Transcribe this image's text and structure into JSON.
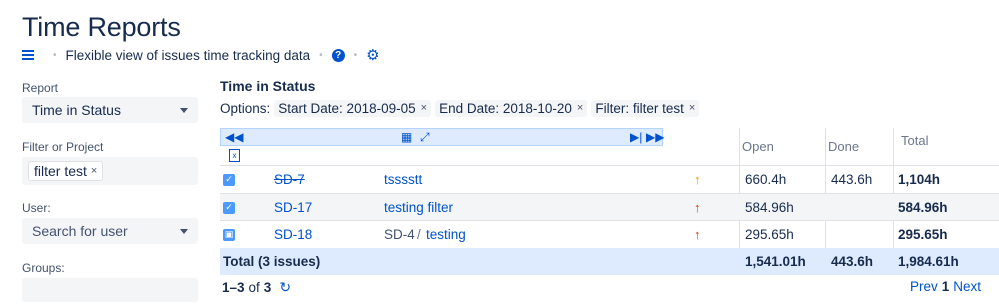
{
  "header": {
    "title": "Time Reports",
    "subtitle": "Flexible view of issues time tracking data",
    "help_glyph": "?",
    "gear_glyph": "⚙"
  },
  "sidebar": {
    "report_label": "Report",
    "report_value": "Time in Status",
    "filter_label": "Filter or Project",
    "filter_tag": "filter test",
    "user_label": "User:",
    "user_placeholder": "Search for user",
    "groups_label": "Groups:"
  },
  "report": {
    "section_title": "Time in Status",
    "options_label": "Options:",
    "options": [
      {
        "label": "Start Date: 2018-09-05"
      },
      {
        "label": "End Date: 2018-10-20"
      },
      {
        "label": "Filter: filter test"
      }
    ],
    "remove_glyph": "×",
    "columns": {
      "open": "Open",
      "done": "Done",
      "total": "Total"
    }
  },
  "rows": [
    {
      "key": "SD-7",
      "summary_parent": "",
      "summary": "tsssstt",
      "priority_color": "#ff8b00",
      "open": "660.4h",
      "done": "443.6h",
      "total": "1,104h",
      "resolved": true,
      "type": "task"
    },
    {
      "key": "SD-17",
      "summary_parent": "",
      "summary": "testing filter",
      "priority_color": "#de350b",
      "open": "584.96h",
      "done": "",
      "total": "584.96h",
      "resolved": false,
      "type": "task"
    },
    {
      "key": "SD-18",
      "summary_parent": "SD-4",
      "summary": "testing",
      "priority_color": "#de350b",
      "open": "295.65h",
      "done": "",
      "total": "295.65h",
      "resolved": false,
      "type": "subtask"
    }
  ],
  "totals": {
    "label": "Total (3 issues)",
    "open": "1,541.01h",
    "done": "443.6h",
    "total": "1,984.61h"
  },
  "pagination": {
    "range": "1–3",
    "of_label": "of",
    "count": "3",
    "prev": "Prev",
    "page": "1",
    "next": "Next"
  },
  "colors": {
    "accent": "#0052cc",
    "toolbar_bg": "#deebff",
    "total_row_bg": "#deebff",
    "alt_row_bg": "#f4f5f7"
  }
}
